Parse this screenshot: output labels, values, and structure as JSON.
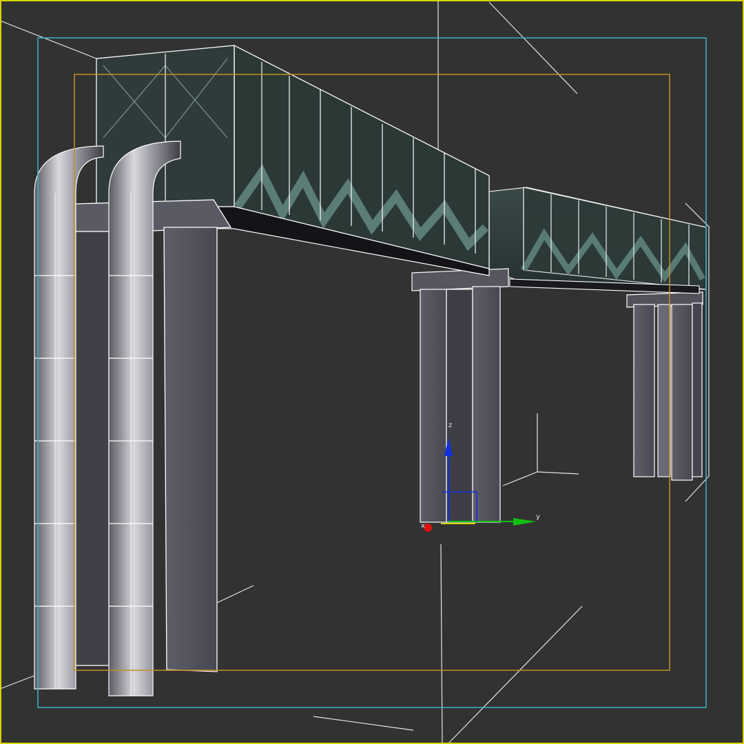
{
  "viewport": {
    "background": "#323232",
    "safe_frame_color": "#39b5c8",
    "render_frame_color": "#c8901e",
    "active_border_color": "#d6d400",
    "wire_color": "#ffffff"
  },
  "gizmo": {
    "x_label": "x",
    "y_label": "y",
    "z_label": "z",
    "x_color": "#e01010",
    "y_color": "#10c010",
    "z_color": "#1030e0"
  },
  "scene_objects": [
    "truss-bridge-section-left",
    "truss-bridge-section-right",
    "pipe-left",
    "pipe-right",
    "support-column-front",
    "support-column-mid",
    "support-column-far"
  ]
}
